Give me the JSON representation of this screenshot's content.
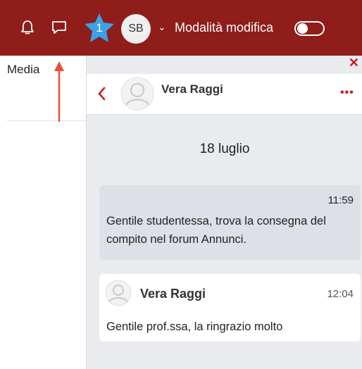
{
  "navbar": {
    "notification_icon": "bell-icon",
    "messages_icon": "chat-bubble-icon",
    "badge_count": "1",
    "badge_color": "#3aa2e6",
    "avatar_initials": "SB",
    "edit_mode_label": "Modalità modifica",
    "edit_mode_on": false,
    "bg_color": "#8f1d1a"
  },
  "page": {
    "visible_label": "Media"
  },
  "drawer": {
    "close_icon": "close-icon",
    "contact_name": "Vera Raggi",
    "date_separator": "18 luglio",
    "messages": [
      {
        "time": "11:59",
        "text": "Gentile studentessa, trova la consegna del compito nel forum Annunci."
      },
      {
        "sender": "Vera Raggi",
        "time": "12:04",
        "text": "Gentile prof.ssa, la ringrazio molto"
      }
    ]
  }
}
